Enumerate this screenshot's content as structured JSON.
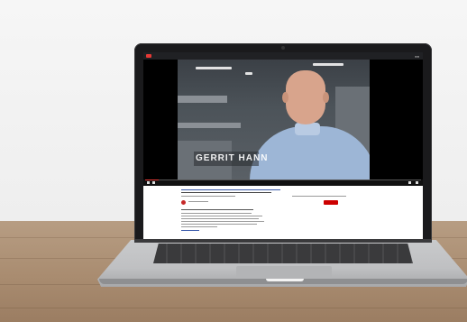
{
  "video": {
    "lower_third": "GERRIT HANN",
    "progress_fraction": 0.05
  },
  "colors": {
    "accent": "#e53935",
    "subscribe": "#cc0000",
    "shirt": "#9db6d6"
  },
  "icons": [
    "youtube-logo-icon",
    "play-icon",
    "volume-icon",
    "settings-icon",
    "fullscreen-icon"
  ]
}
